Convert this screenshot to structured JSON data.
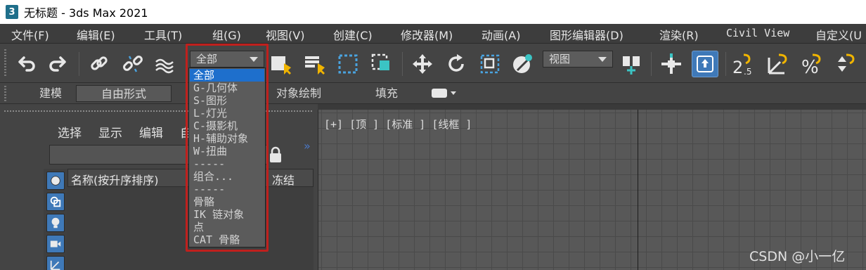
{
  "window": {
    "title": "无标题 - 3ds Max 2021",
    "logo_text": "3"
  },
  "menu": [
    "文件(F)",
    "编辑(E)",
    "工具(T)",
    "组(G)",
    "视图(V)",
    "创建(C)",
    "修改器(M)",
    "动画(A)",
    "图形编辑器(D)",
    "渲染(R)",
    "Civil View",
    "自定义(U"
  ],
  "toolbar": {
    "selection_filter": "全部",
    "reference_coord": "视图",
    "snap_label": "2.5"
  },
  "ribbon": {
    "tabs": [
      "建模",
      "自由形式",
      "对象绘制",
      "填充"
    ],
    "active": "自由形式"
  },
  "scene_explorer": {
    "menu": [
      "选择",
      "显示",
      "编辑",
      "自"
    ],
    "column_name": "名称(按升序排序)",
    "column_frozen": "冻结",
    "icons": [
      "sphere-icon",
      "shapes-icon",
      "light-icon",
      "camera-icon",
      "helper-icon"
    ]
  },
  "viewport": {
    "label": "[+] [顶 ] [标准 ] [线框 ]"
  },
  "dropdown": {
    "items": [
      "全部",
      "G-几何体",
      "S-图形",
      "L-灯光",
      "C-摄影机",
      "H-辅助对象",
      "W-扭曲",
      "-----",
      "组合...",
      "-----",
      "骨骼",
      "IK 链对象",
      "点",
      "CAT 骨骼"
    ],
    "selected": "全部"
  },
  "watermark": "CSDN @小一亿",
  "colors": {
    "highlight_border": "#c0201d",
    "selected_item": "#1e6fcc",
    "active_tool": "#3f79b8"
  }
}
